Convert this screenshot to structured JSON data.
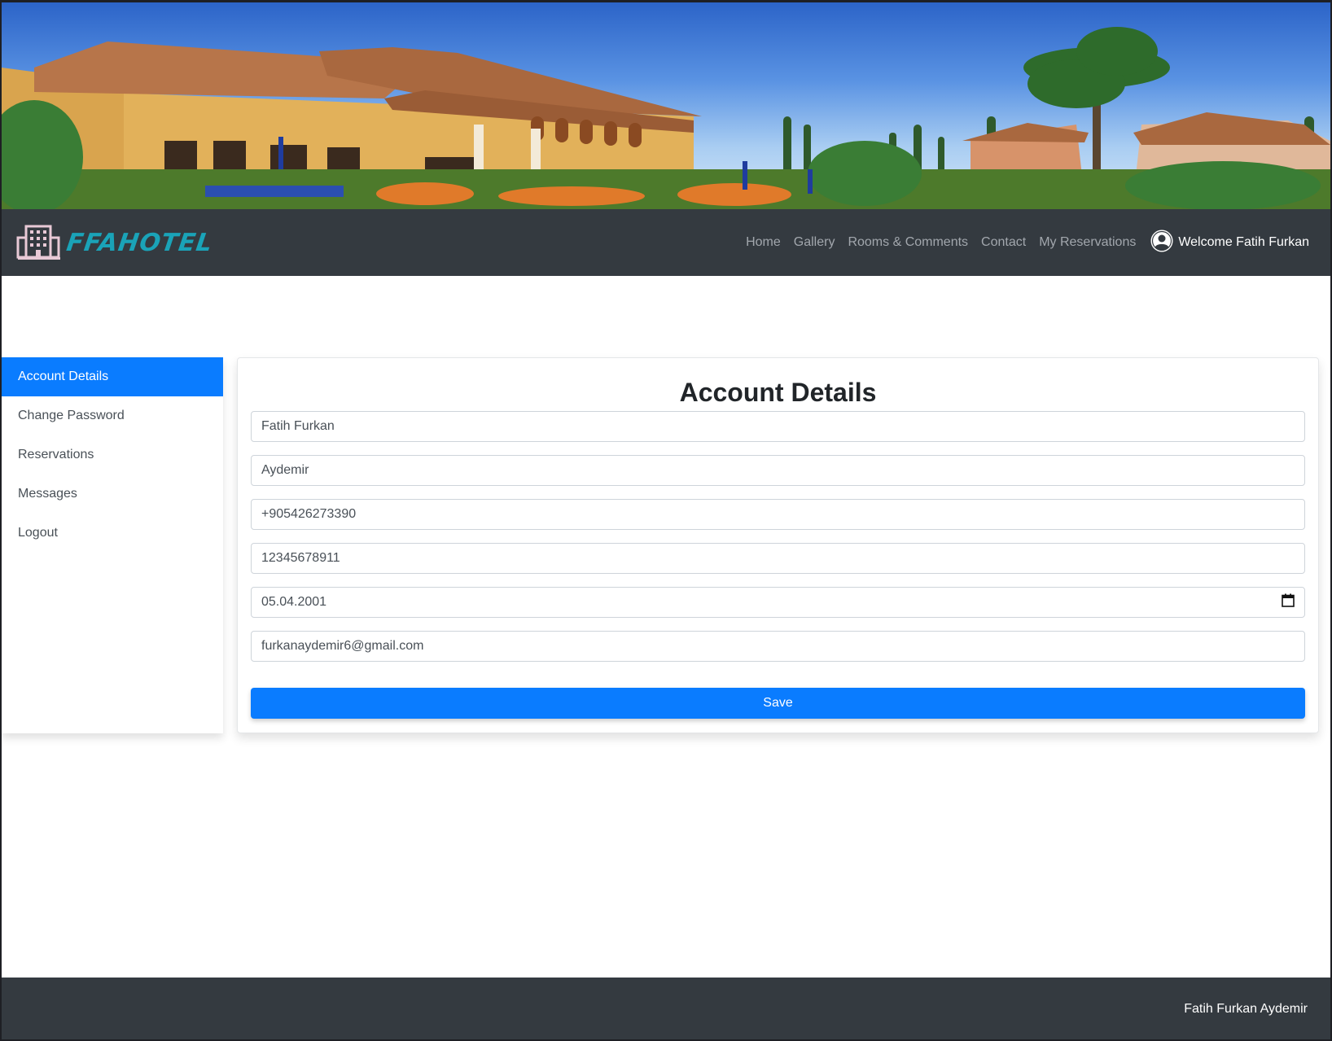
{
  "brand": {
    "name": "FFAHOTEL",
    "logo_icon": "hotel-building-icon",
    "color": "#1aa3b8"
  },
  "nav": {
    "links": [
      "Home",
      "Gallery",
      "Rooms & Comments",
      "Contact",
      "My Reservations"
    ],
    "user_icon": "user-avatar-icon",
    "welcome": "Welcome Fatih Furkan"
  },
  "sidebar": {
    "items": [
      {
        "label": "Account Details",
        "active": true
      },
      {
        "label": "Change Password",
        "active": false
      },
      {
        "label": "Reservations",
        "active": false
      },
      {
        "label": "Messages",
        "active": false
      },
      {
        "label": "Logout",
        "active": false
      }
    ]
  },
  "form": {
    "title": "Account Details",
    "first_name": "Fatih Furkan",
    "last_name": "Aydemir",
    "phone": "+905426273390",
    "id_number": "12345678911",
    "birth_date": "05.04.2001",
    "email": "furkanaydemir6@gmail.com",
    "save_label": "Save"
  },
  "footer": {
    "text": "Fatih Furkan Aydemir"
  },
  "colors": {
    "primary": "#0a7cff",
    "navbar": "#343a40"
  }
}
